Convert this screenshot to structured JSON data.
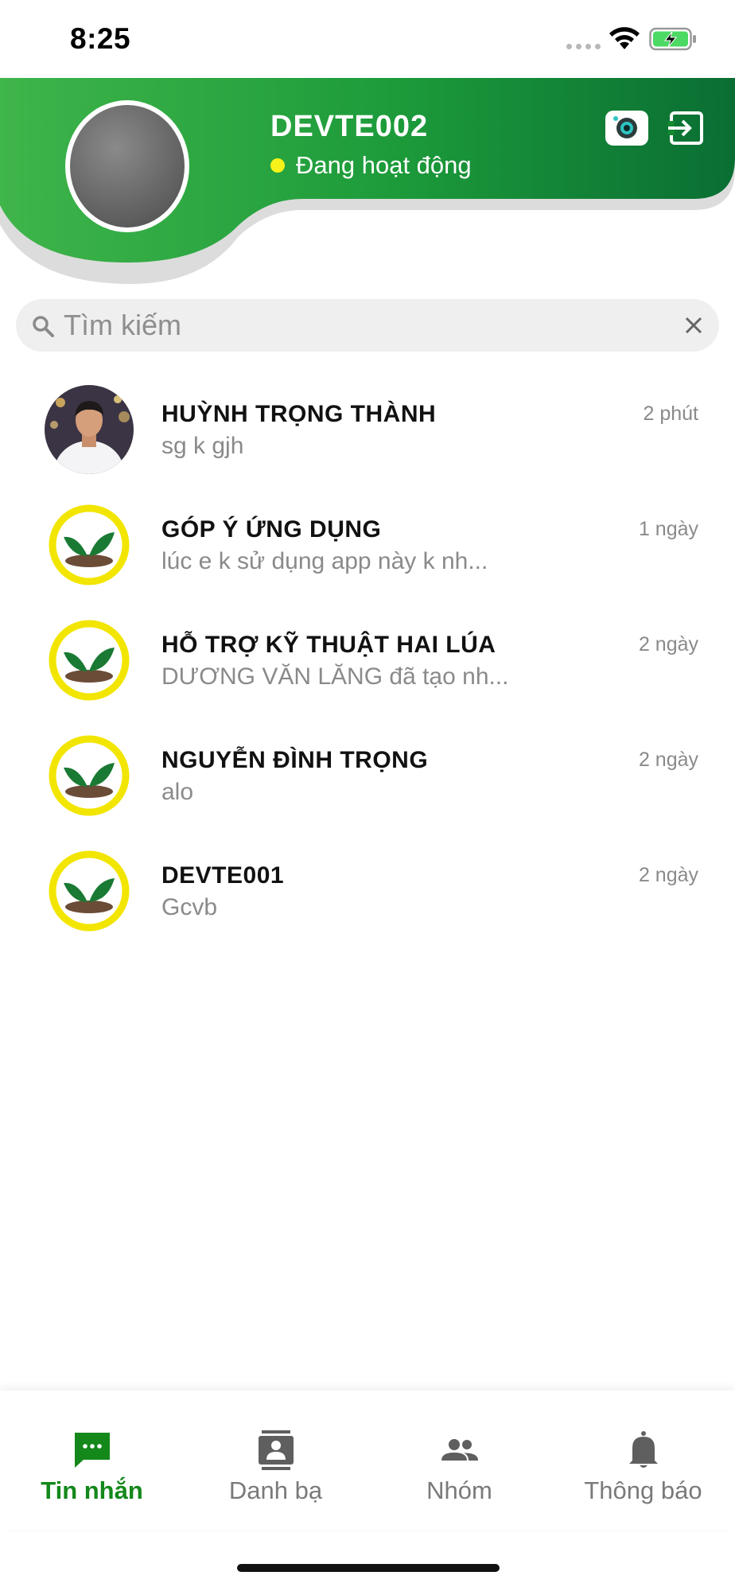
{
  "status_bar": {
    "time": "8:25"
  },
  "header": {
    "user_name": "DEVTE002",
    "status_text": "Đang hoạt động",
    "brand_green": "#138a2e",
    "status_dot_color": "#f6f21a"
  },
  "search": {
    "placeholder": "Tìm kiếm"
  },
  "conversations": [
    {
      "name": "HUỲNH TRỌNG THÀNH",
      "last_message": "sg k gjh",
      "time": "2 phút",
      "avatar": "photo"
    },
    {
      "name": "GÓP Ý ỨNG DỤNG",
      "last_message": "lúc e k sử dụng app này k nh...",
      "time": "1 ngày",
      "avatar": "leaf-logo"
    },
    {
      "name": "HỖ TRỢ KỸ THUẬT HAI LÚA",
      "last_message": "DƯƠNG VĂN LĂNG đã tạo nh...",
      "time": "2 ngày",
      "avatar": "leaf-logo"
    },
    {
      "name": "NGUYỄN ĐÌNH TRỌNG",
      "last_message": "alo",
      "time": "2 ngày",
      "avatar": "leaf-logo"
    },
    {
      "name": "DEVTE001",
      "last_message": "Gcvb",
      "time": "2 ngày",
      "avatar": "leaf-logo"
    }
  ],
  "tabs": [
    {
      "label": "Tin nhắn",
      "icon": "chat-icon",
      "active": true
    },
    {
      "label": "Danh bạ",
      "icon": "contacts-icon",
      "active": false
    },
    {
      "label": "Nhóm",
      "icon": "group-icon",
      "active": false
    },
    {
      "label": "Thông báo",
      "icon": "bell-icon",
      "active": false
    }
  ]
}
